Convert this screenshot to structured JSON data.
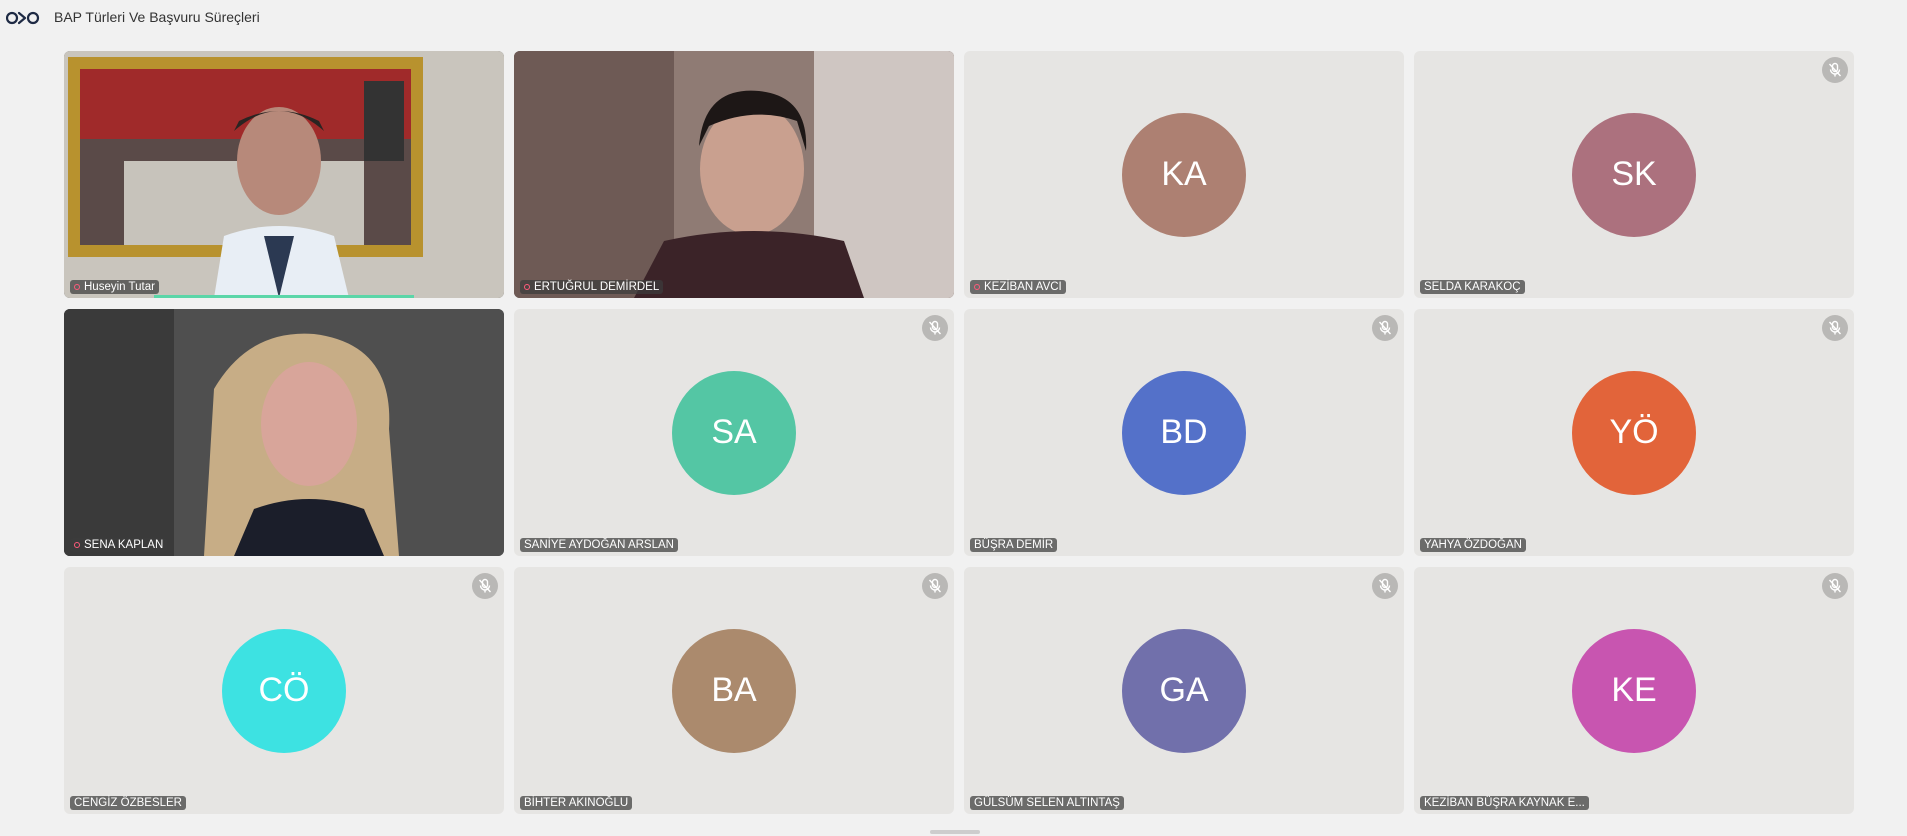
{
  "header": {
    "title": "BAP Türleri Ve Başvuru Süreçleri"
  },
  "participants": [
    {
      "name": "Huseyin Tutar",
      "video": true,
      "muted": false,
      "speaking": true,
      "scene": "office-portrait"
    },
    {
      "name": "ERTUĞRUL DEMİRDEL",
      "video": true,
      "muted": false,
      "speaking": true,
      "scene": "room-man"
    },
    {
      "name": "KEZİBAN AVCI",
      "initials": "KA",
      "color": "#ad8072",
      "muted": false,
      "speaking": true
    },
    {
      "name": "SELDA KARAKOÇ",
      "initials": "SK",
      "color": "#ac717e",
      "muted": true,
      "speaking": false
    },
    {
      "name": "SENA KAPLAN",
      "video": true,
      "muted": false,
      "speaking": true,
      "scene": "room-woman"
    },
    {
      "name": "SANİYE AYDOĞAN ARSLAN",
      "initials": "SA",
      "color": "#54c6a4",
      "muted": true,
      "speaking": false
    },
    {
      "name": "BÜŞRA DEMİR",
      "initials": "BD",
      "color": "#5471c9",
      "muted": true,
      "speaking": false
    },
    {
      "name": "YAHYA ÖZDOĞAN",
      "initials": "YÖ",
      "color": "#e2643a",
      "muted": true,
      "speaking": false
    },
    {
      "name": "CENGİZ ÖZBESLER",
      "initials": "CÖ",
      "color": "#3de2e2",
      "muted": true,
      "speaking": false
    },
    {
      "name": "BİHTER AKINOĞLU",
      "initials": "BA",
      "color": "#ab8a6d",
      "muted": true,
      "speaking": false
    },
    {
      "name": "GÜLSÜM SELEN ALTINTAŞ",
      "initials": "GA",
      "color": "#7170ab",
      "muted": true,
      "speaking": false
    },
    {
      "name": "KEZİBAN BÜŞRA KAYNAK E...",
      "initials": "KE",
      "color": "#c855b0",
      "muted": true,
      "speaking": false
    }
  ]
}
